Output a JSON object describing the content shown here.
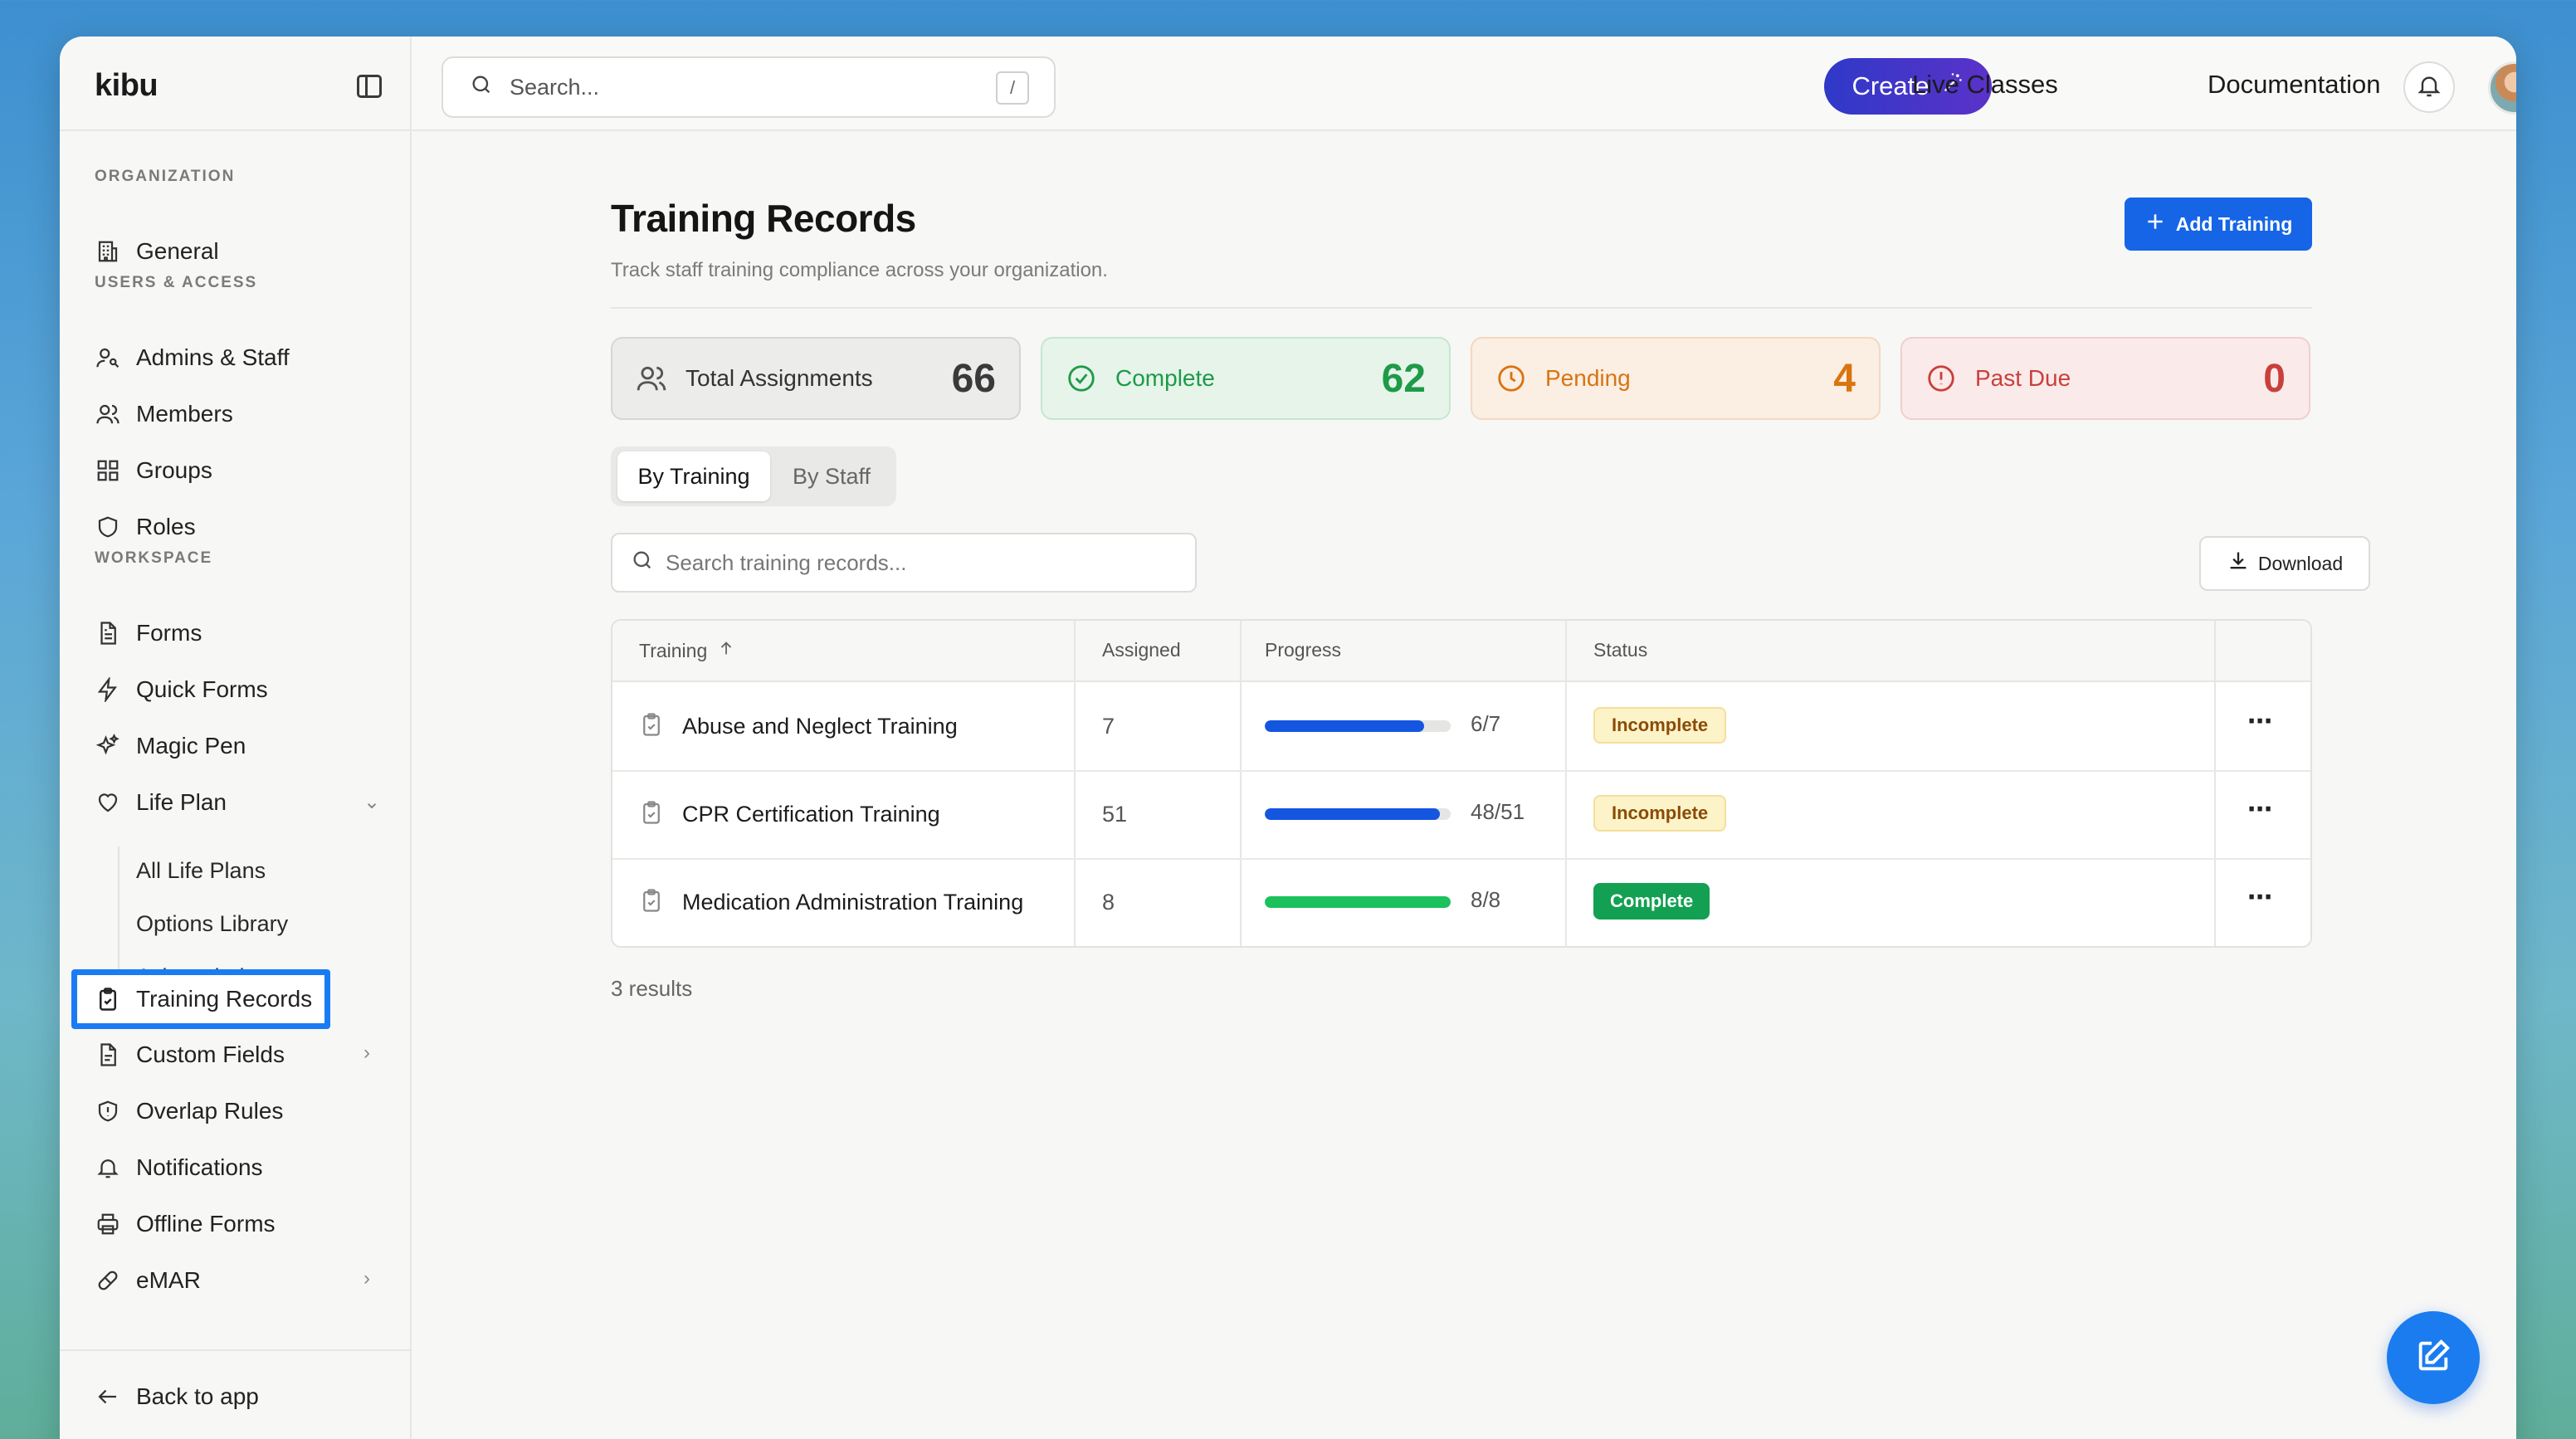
{
  "app": {
    "brand": "kibu"
  },
  "search": {
    "placeholder": "Search...",
    "shortcut": "/"
  },
  "topbar": {
    "create_label": "Create",
    "links": [
      "Live Classes",
      "Documentation"
    ]
  },
  "sidebar": {
    "sections": {
      "organization": "ORGANIZATION",
      "users_access": "USERS & ACCESS",
      "workspace": "WORKSPACE"
    },
    "items": {
      "general": "General",
      "admins_staff": "Admins & Staff",
      "members": "Members",
      "groups": "Groups",
      "roles": "Roles",
      "forms": "Forms",
      "quick_forms": "Quick Forms",
      "magic_pen": "Magic Pen",
      "life_plan": "Life Plan",
      "all_life_plans": "All Life Plans",
      "options_library": "Options Library",
      "acknowledgements": "Acknowledgements",
      "training_records": "Training Records",
      "custom_fields": "Custom Fields",
      "overlap_rules": "Overlap Rules",
      "notifications": "Notifications",
      "offline_forms": "Offline Forms",
      "emar": "eMAR"
    },
    "back_label": "Back to app"
  },
  "page": {
    "title": "Training Records",
    "subtitle": "Track staff training compliance across your organization.",
    "add_button": "Add Training"
  },
  "stats": [
    {
      "label": "Total Assignments",
      "value": "66",
      "color": "#3a3a3a"
    },
    {
      "label": "Complete",
      "value": "62",
      "color": "#1e9a48"
    },
    {
      "label": "Pending",
      "value": "4",
      "color": "#d9740f"
    },
    {
      "label": "Past Due",
      "value": "0",
      "color": "#c8403c"
    }
  ],
  "tabs": {
    "by_training": "By Training",
    "by_staff": "By Staff"
  },
  "table_search": {
    "placeholder": "Search training records..."
  },
  "download_label": "Download",
  "table": {
    "headers": {
      "training": "Training",
      "assigned": "Assigned",
      "progress": "Progress",
      "status": "Status"
    },
    "rows": [
      {
        "training": "Abuse and Neglect Training",
        "assigned": "7",
        "progress": "6/7",
        "fraction": 0.857,
        "status": "Incomplete"
      },
      {
        "training": "CPR Certification Training",
        "assigned": "51",
        "progress": "48/51",
        "fraction": 0.941,
        "status": "Incomplete"
      },
      {
        "training": "Medication Administration Training",
        "assigned": "8",
        "progress": "8/8",
        "fraction": 1.0,
        "status": "Complete"
      }
    ]
  },
  "results_text": "3 results",
  "colors": {
    "accent": "#1565e6",
    "incomplete_bg": "#fdf3c8",
    "incomplete_text": "#8a4b08",
    "complete_bg": "#13a052",
    "progress_blue": "#1556e0",
    "progress_green": "#1bc15a"
  }
}
